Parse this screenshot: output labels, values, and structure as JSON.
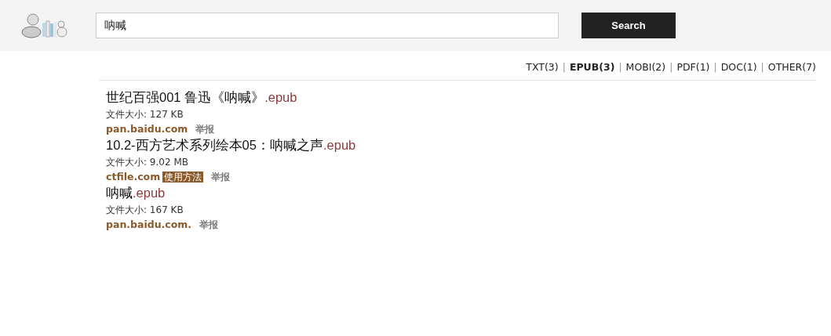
{
  "search": {
    "value": "呐喊",
    "button": "Search"
  },
  "filter_separator": "|",
  "filters": [
    {
      "label": "TXT(3)",
      "selected": false
    },
    {
      "label": "EPUB(3)",
      "selected": true
    },
    {
      "label": "MOBI(2)",
      "selected": false
    },
    {
      "label": "PDF(1)",
      "selected": false
    },
    {
      "label": "DOC(1)",
      "selected": false
    },
    {
      "label": "OTHER(7)",
      "selected": false
    }
  ],
  "results": [
    {
      "name": "世纪百强001 鲁迅《呐喊》",
      "ext": ".epub",
      "size": "文件大小: 127 KB",
      "source": "pan.baidu.com",
      "report": "举报"
    },
    {
      "name": "10.2-西方艺术系列绘本05：呐喊之声",
      "ext": ".epub",
      "size": "文件大小: 9.02 MB",
      "source": "ctfile.com",
      "howto": "使用方法",
      "report": "举报"
    },
    {
      "name": "呐喊",
      "ext": ".epub",
      "size": "文件大小: 167 KB",
      "source": "pan.baidu.com.",
      "report": "举报"
    }
  ]
}
